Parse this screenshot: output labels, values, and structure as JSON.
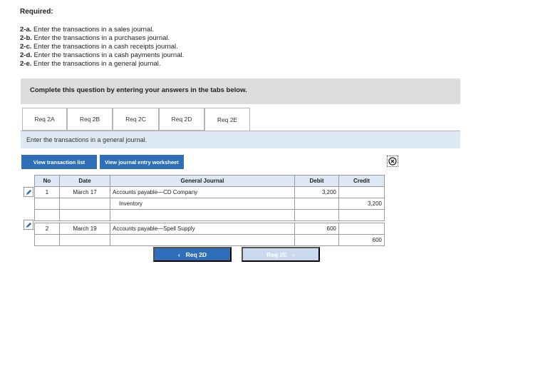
{
  "required_title": "Required:",
  "requirements": [
    {
      "code": "2-a.",
      "text": "Enter the transactions in a sales journal."
    },
    {
      "code": "2-b.",
      "text": "Enter the transactions in a purchases journal."
    },
    {
      "code": "2-c.",
      "text": "Enter the transactions in a cash receipts journal."
    },
    {
      "code": "2-d.",
      "text": "Enter the transactions in a cash payments journal."
    },
    {
      "code": "2-e.",
      "text": "Enter the transactions in a general journal."
    }
  ],
  "instruction": "Complete this question by entering your answers in the tabs below.",
  "tabs": [
    {
      "label": "Req 2A"
    },
    {
      "label": "Req 2B"
    },
    {
      "label": "Req 2C"
    },
    {
      "label": "Req 2D"
    },
    {
      "label": "Req 2E",
      "active": true
    }
  ],
  "prompt": "Enter the transactions in a general journal.",
  "buttons": {
    "view_transactions": "View transaction list",
    "view_worksheet": "View journal entry worksheet"
  },
  "icons": {
    "close": "close-icon",
    "edit": "pencil-icon"
  },
  "table": {
    "headers": {
      "no": "No",
      "date": "Date",
      "journal": "General Journal",
      "debit": "Debit",
      "credit": "Credit"
    },
    "entries": [
      {
        "no": "1",
        "date": "March 17",
        "lines": [
          {
            "account": "Accounts payable—CD Company",
            "debit": "3,200",
            "credit": ""
          },
          {
            "account": "Inventory",
            "debit": "",
            "credit": "3,200"
          }
        ]
      },
      {
        "no": "2",
        "date": "March 19",
        "lines": [
          {
            "account": "Accounts payable—Spell Supply",
            "debit": "600",
            "credit": ""
          },
          {
            "account": "",
            "debit": "",
            "credit": "600"
          }
        ]
      }
    ]
  },
  "nav": {
    "prev_label": "Req 2D",
    "next_label": "Req 2E"
  },
  "colors": {
    "primary": "#2f6fba",
    "disabled": "#c9d9ee",
    "header_bg": "#dde8f4",
    "prompt_bg": "#ddeaf6"
  }
}
